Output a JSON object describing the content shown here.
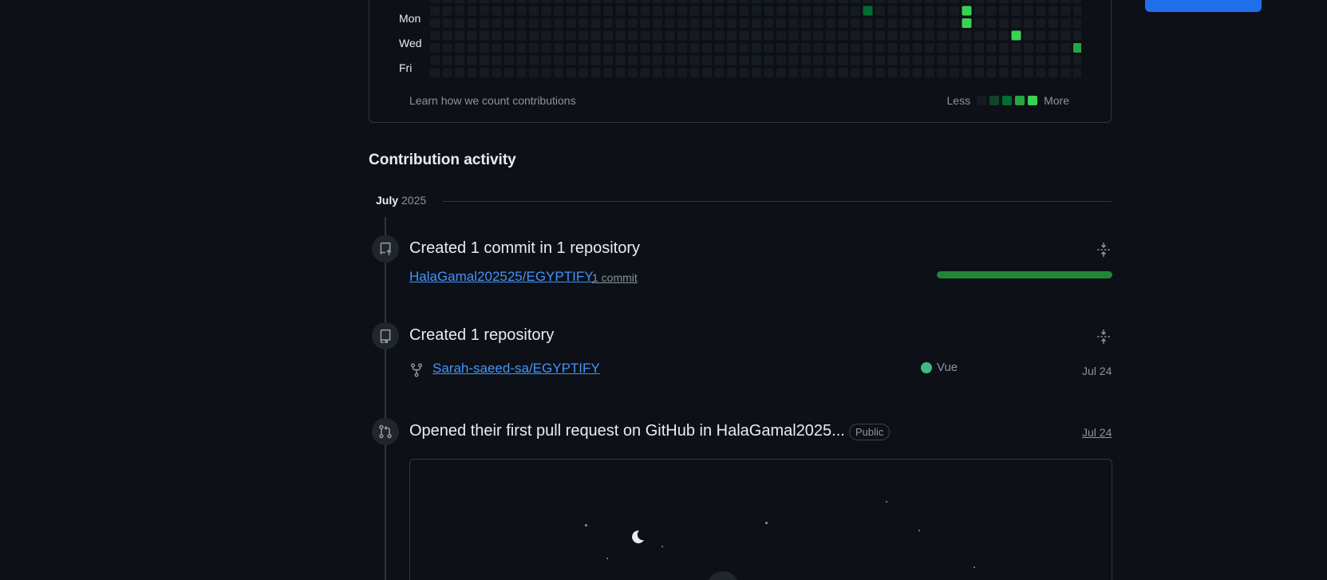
{
  "graph": {
    "day_labels": [
      "Mon",
      "Wed",
      "Fri"
    ],
    "learn_link": "Learn how we count contributions",
    "legend": {
      "less": "Less",
      "more": "More",
      "level_colors": [
        "#161b22",
        "#0e4429",
        "#006d32",
        "#26a641",
        "#39d353"
      ]
    },
    "weeks": 53,
    "visible_rows": 7,
    "active_cells": [
      {
        "week": 35,
        "row": 1,
        "level": 2
      },
      {
        "week": 43,
        "row": 1,
        "level": 4
      },
      {
        "week": 43,
        "row": 2,
        "level": 4
      },
      {
        "week": 47,
        "row": 3,
        "level": 4
      },
      {
        "week": 52,
        "row": 4,
        "level": 3
      }
    ]
  },
  "activity": {
    "title": "Contribution activity",
    "month": "July",
    "year": "2025",
    "items": [
      {
        "icon": "repo-push-icon",
        "title": "Created 1 commit in 1 repository",
        "repo": "HalaGamal202525/EGYPTIFY",
        "count": "1 commit",
        "progress": 1.0
      },
      {
        "icon": "repo-icon",
        "title": "Created 1 repository",
        "repo": "Sarah-saeed-sa/EGYPTIFY",
        "language": "Vue",
        "language_color": "#41b883",
        "date": "Jul 24"
      },
      {
        "icon": "git-pull-request-icon",
        "title": "Opened their first pull request on GitHub in HalaGamal2025...",
        "badge": "Public",
        "date": "Jul 24"
      }
    ]
  },
  "colors": {
    "background": "#0d1117",
    "link": "#4493f8",
    "accent_button": "#1f6feb",
    "progress": "#238636"
  }
}
